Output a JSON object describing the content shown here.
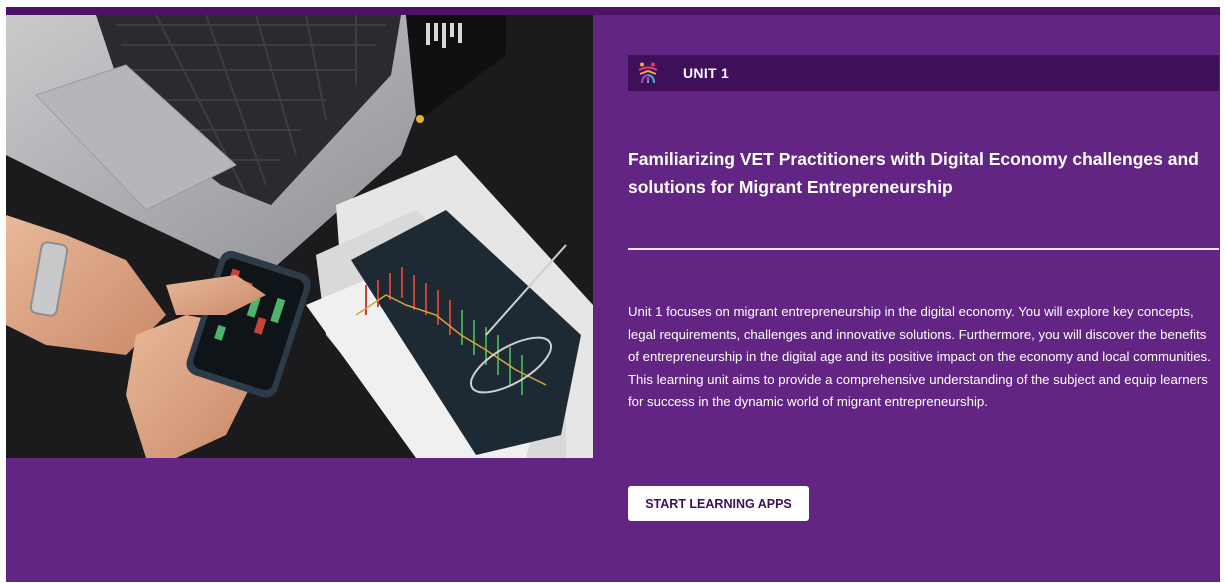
{
  "unit": {
    "icon": "people-network-logo-icon",
    "label": "UNIT 1"
  },
  "title": "Familiarizing VET Practitioners with Digital Economy challenges and solutions for Migrant Entrepreneurship",
  "description": "Unit 1 focuses on migrant entrepreneurship in the digital economy. You will explore key concepts, legal requirements, challenges and innovative solutions. Furthermore, you will discover the benefits of entrepreneurship in the digital age and its positive impact on the economy and local communities. This learning unit aims to provide a comprehensive understanding of the subject and equip learners for success in the dynamic world of migrant entrepreneurship.",
  "cta": {
    "label": "START LEARNING APPS"
  },
  "colors": {
    "background": "#622584",
    "unit_bar": "#3f0f5a",
    "button_text": "#3f0f5a"
  }
}
